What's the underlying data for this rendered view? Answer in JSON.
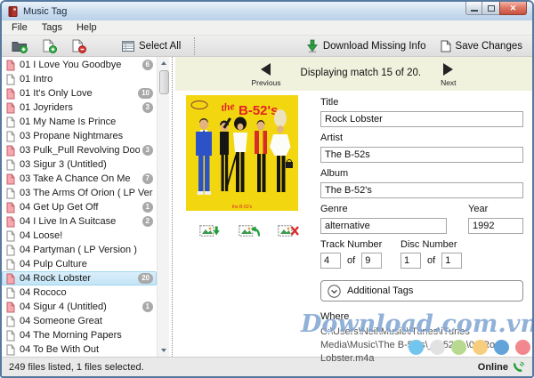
{
  "window": {
    "title": "Music Tag"
  },
  "menu": {
    "items": [
      "File",
      "Tags",
      "Help"
    ]
  },
  "toolbar": {
    "select_all": "Select All",
    "download_missing": "Download Missing Info",
    "save_changes": "Save Changes"
  },
  "file_list": {
    "files": [
      {
        "name": "01 I Love You Goodbye",
        "badge": "6",
        "modified": true
      },
      {
        "name": "01 Intro",
        "badge": "",
        "modified": false
      },
      {
        "name": "01 It's Only Love",
        "badge": "10",
        "modified": true
      },
      {
        "name": "01 Joyriders",
        "badge": "3",
        "modified": true
      },
      {
        "name": "01 My Name Is Prince",
        "badge": "",
        "modified": false
      },
      {
        "name": "03 Propane Nightmares",
        "badge": "",
        "modified": false
      },
      {
        "name": "03 Pulk_Pull Revolving Doors",
        "badge": "3",
        "modified": true
      },
      {
        "name": "03 Sigur 3 (Untitled)",
        "badge": "",
        "modified": false
      },
      {
        "name": "03 Take A Chance On Me",
        "badge": "7",
        "modified": true
      },
      {
        "name": "03 The Arms Of Orion ( LP Version )",
        "badge": "",
        "modified": false
      },
      {
        "name": "04 Get Up Get Off",
        "badge": "1",
        "modified": true
      },
      {
        "name": "04 I Live In A Suitcase",
        "badge": "2",
        "modified": true
      },
      {
        "name": "04 Loose!",
        "badge": "",
        "modified": false
      },
      {
        "name": "04 Partyman ( LP Version )",
        "badge": "",
        "modified": false
      },
      {
        "name": "04 Pulp Culture",
        "badge": "",
        "modified": false
      },
      {
        "name": "04 Rock Lobster",
        "badge": "20",
        "modified": true,
        "selected": true
      },
      {
        "name": "04 Rococo",
        "badge": "",
        "modified": false
      },
      {
        "name": "04 Sigur 4 (Untitled)",
        "badge": "1",
        "modified": true
      },
      {
        "name": "04 Someone Great",
        "badge": "",
        "modified": false
      },
      {
        "name": "04 The Morning Papers",
        "badge": "",
        "modified": false
      },
      {
        "name": "04 To Be With Out",
        "badge": "",
        "modified": false
      }
    ]
  },
  "nav": {
    "previous": "Previous",
    "status": "Displaying match 15 of 20.",
    "next": "Next"
  },
  "album_art": {
    "title_the": "the",
    "title_name": "B-52's",
    "bottom_caption": "the B-52's"
  },
  "fields": {
    "title": {
      "label": "Title",
      "value": "Rock Lobster"
    },
    "artist": {
      "label": "Artist",
      "value": "The B-52s"
    },
    "album": {
      "label": "Album",
      "value": "The B-52's"
    },
    "genre": {
      "label": "Genre",
      "value": "alternative"
    },
    "year": {
      "label": "Year",
      "value": "1992"
    },
    "track": {
      "label": "Track Number",
      "value": "4",
      "of": "of",
      "total": "9"
    },
    "disc": {
      "label": "Disc Number",
      "value": "1",
      "of": "of",
      "total": "1"
    },
    "additional_tags": "Additional Tags",
    "where": {
      "label": "Where",
      "path": "C:\\Users\\Neil\\Music\\iTunes\\iTunes Media\\Music\\The B-52's\\_B-52's_\\04 Rock Lobster.m4a"
    }
  },
  "watermark": {
    "text": "Download.com.vn",
    "dot_colors": [
      "#72c5ee",
      "#e2e2e2",
      "#b8da90",
      "#f7cd7e",
      "#62a4da",
      "#f2878d"
    ]
  },
  "status_bar": {
    "left": "249 files listed, 1 files selected.",
    "online": "Online"
  }
}
